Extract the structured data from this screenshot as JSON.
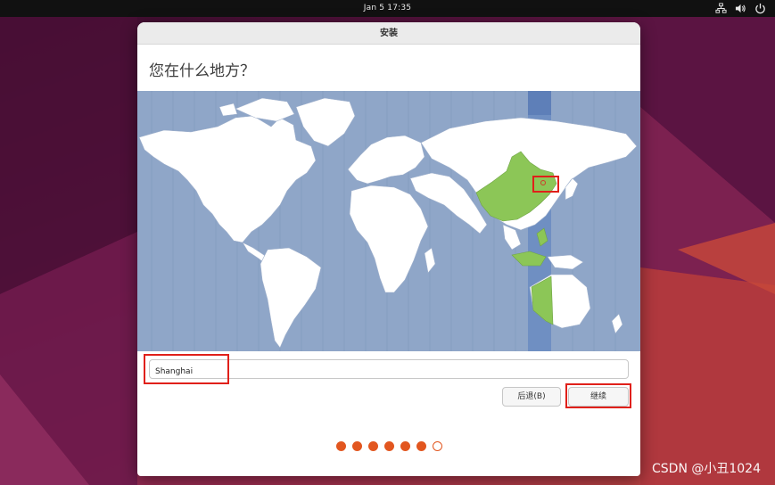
{
  "topbar": {
    "clock": "Jan 5  17:35",
    "tray_icons": [
      "network-icon",
      "volume-icon",
      "power-icon"
    ]
  },
  "window": {
    "title": "安装",
    "heading": "您在什么地方？"
  },
  "map": {
    "selected_city": "Shanghai",
    "land_color": "#ffffff",
    "highlight_color": "#8cc657",
    "ocean_color": "#8fa6c8"
  },
  "timezone_input": {
    "value": "Shanghai"
  },
  "buttons": {
    "back_label": "后退(B)",
    "continue_label": "继续"
  },
  "progress": {
    "total_steps": 7,
    "current_step": 6
  },
  "watermark": "CSDN @小丑1024",
  "colors": {
    "accent": "#e2561f",
    "annotation": "#e0201a"
  }
}
